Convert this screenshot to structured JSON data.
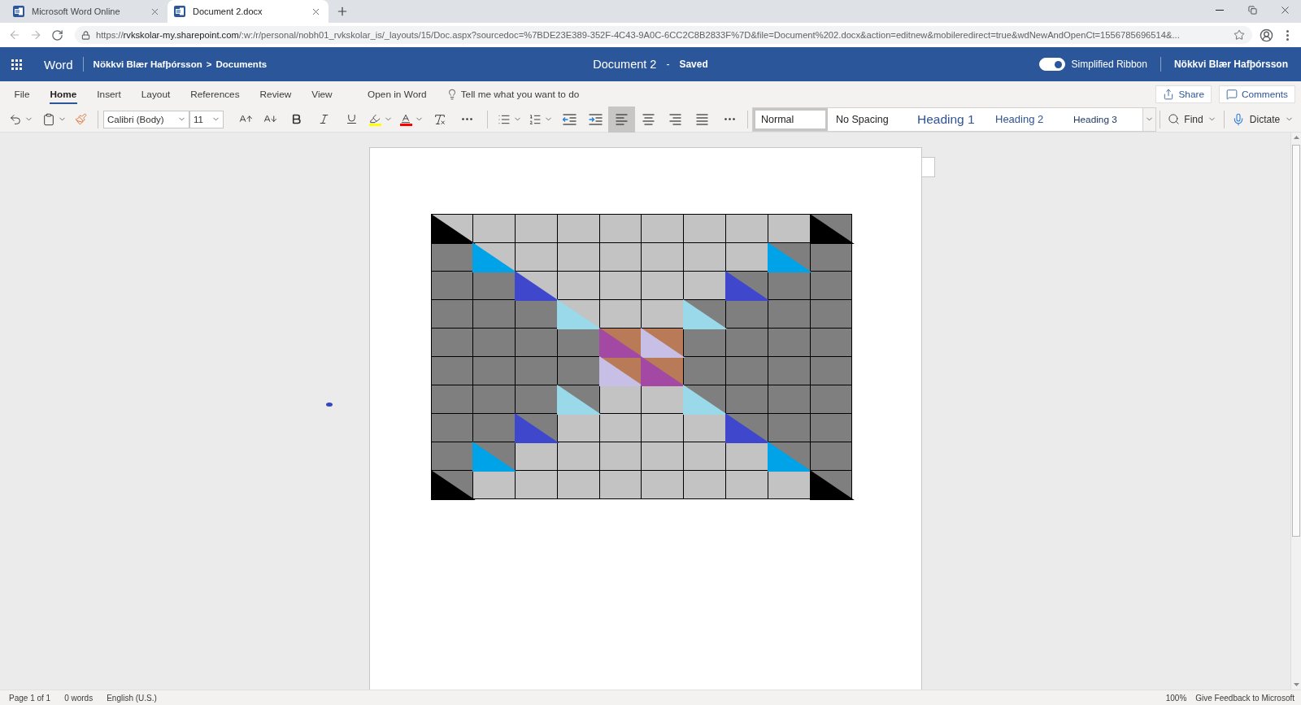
{
  "browser": {
    "tabs": [
      {
        "title": "Microsoft Word Online",
        "selected": false
      },
      {
        "title": "Document 2.docx",
        "selected": true
      }
    ],
    "address": {
      "scheme": "https://",
      "host": "rvkskolar-my.sharepoint.com",
      "rest": "/:w:/r/personal/nobh01_rvkskolar_is/_layouts/15/Doc.aspx?sourcedoc=%7BDE23E389-352F-4C43-9A0C-6CC2C8B2833F%7D&file=Document%202.docx&action=editnew&mobileredirect=true&wdNewAndOpenCt=1556785696514&..."
    }
  },
  "app_bar": {
    "app_name": "Word",
    "breadcrumb": {
      "owner": "Nökkvi Blær Hafþórsson",
      "separator": ">",
      "folder": "Documents"
    },
    "document_title": "Document 2",
    "title_separator": "-",
    "save_status": "Saved",
    "simplified_ribbon": {
      "label": "Simplified Ribbon",
      "on": true
    },
    "user_name": "Nökkvi Blær Hafþórsson"
  },
  "ribbon": {
    "tabs": [
      {
        "label": "File",
        "selected": false
      },
      {
        "label": "Home",
        "selected": true
      },
      {
        "label": "Insert",
        "selected": false
      },
      {
        "label": "Layout",
        "selected": false
      },
      {
        "label": "References",
        "selected": false
      },
      {
        "label": "Review",
        "selected": false
      },
      {
        "label": "View",
        "selected": false
      }
    ],
    "open_in_word": "Open in Word",
    "tell_me": "Tell me what you want to do",
    "share": "Share",
    "comments": "Comments"
  },
  "toolbar": {
    "font_name": "Calibri (Body)",
    "font_size": "11",
    "alignment": [
      {
        "selected": true
      },
      {
        "selected": false
      },
      {
        "selected": false
      },
      {
        "selected": false
      }
    ],
    "styles": [
      {
        "label": "Normal",
        "kind": "body",
        "selected": true
      },
      {
        "label": "No Spacing",
        "kind": "body",
        "selected": false
      },
      {
        "label": "Heading 1",
        "kind": "heading1",
        "selected": false
      },
      {
        "label": "Heading 2",
        "kind": "heading2",
        "selected": false
      },
      {
        "label": "Heading 3",
        "kind": "heading3",
        "selected": false
      }
    ],
    "find": "Find",
    "dictate": "Dictate"
  },
  "document": {
    "grid": {
      "rows": [
        {
          "cells": [
            {
              "kind": "split",
              "color": "#c3c3c3",
              "triangle": {
                "color": "#000000"
              }
            },
            {
              "kind": "plain",
              "color": "#c3c3c3"
            },
            {
              "kind": "plain",
              "color": "#c3c3c3"
            },
            {
              "kind": "plain",
              "color": "#c3c3c3"
            },
            {
              "kind": "plain",
              "color": "#c3c3c3"
            },
            {
              "kind": "plain",
              "color": "#c3c3c3"
            },
            {
              "kind": "plain",
              "color": "#c3c3c3"
            },
            {
              "kind": "plain",
              "color": "#c3c3c3"
            },
            {
              "kind": "plain",
              "color": "#c3c3c3"
            },
            {
              "kind": "split",
              "color": "#7f7f7f",
              "triangle": {
                "color": "#000000"
              }
            }
          ]
        },
        {
          "cells": [
            {
              "kind": "plain",
              "color": "#7f7f7f"
            },
            {
              "kind": "split",
              "color": "#c3c3c3",
              "triangle": {
                "color": "#00a2e8"
              }
            },
            {
              "kind": "plain",
              "color": "#c3c3c3"
            },
            {
              "kind": "plain",
              "color": "#c3c3c3"
            },
            {
              "kind": "plain",
              "color": "#c3c3c3"
            },
            {
              "kind": "plain",
              "color": "#c3c3c3"
            },
            {
              "kind": "plain",
              "color": "#c3c3c3"
            },
            {
              "kind": "plain",
              "color": "#c3c3c3"
            },
            {
              "kind": "split",
              "color": "#7f7f7f",
              "triangle": {
                "color": "#00a2e8"
              }
            },
            {
              "kind": "plain",
              "color": "#7f7f7f"
            }
          ]
        },
        {
          "cells": [
            {
              "kind": "plain",
              "color": "#7f7f7f"
            },
            {
              "kind": "plain",
              "color": "#7f7f7f"
            },
            {
              "kind": "split",
              "color": "#c3c3c3",
              "triangle": {
                "color": "#3f48cc"
              }
            },
            {
              "kind": "plain",
              "color": "#c3c3c3"
            },
            {
              "kind": "plain",
              "color": "#c3c3c3"
            },
            {
              "kind": "plain",
              "color": "#c3c3c3"
            },
            {
              "kind": "plain",
              "color": "#c3c3c3"
            },
            {
              "kind": "split",
              "color": "#7f7f7f",
              "triangle": {
                "color": "#3f48cc"
              }
            },
            {
              "kind": "plain",
              "color": "#7f7f7f"
            },
            {
              "kind": "plain",
              "color": "#7f7f7f"
            }
          ]
        },
        {
          "cells": [
            {
              "kind": "plain",
              "color": "#7f7f7f"
            },
            {
              "kind": "plain",
              "color": "#7f7f7f"
            },
            {
              "kind": "plain",
              "color": "#7f7f7f"
            },
            {
              "kind": "split",
              "color": "#c3c3c3",
              "triangle": {
                "color": "#99d9ea"
              }
            },
            {
              "kind": "plain",
              "color": "#c3c3c3"
            },
            {
              "kind": "plain",
              "color": "#c3c3c3"
            },
            {
              "kind": "split",
              "color": "#7f7f7f",
              "triangle": {
                "color": "#99d9ea"
              }
            },
            {
              "kind": "plain",
              "color": "#7f7f7f"
            },
            {
              "kind": "plain",
              "color": "#7f7f7f"
            },
            {
              "kind": "plain",
              "color": "#7f7f7f"
            }
          ]
        },
        {
          "cells": [
            {
              "kind": "plain",
              "color": "#7f7f7f"
            },
            {
              "kind": "plain",
              "color": "#7f7f7f"
            },
            {
              "kind": "plain",
              "color": "#7f7f7f"
            },
            {
              "kind": "plain",
              "color": "#7f7f7f"
            },
            {
              "kind": "split",
              "color": "#b97a57",
              "triangle": {
                "color": "#a349a4"
              }
            },
            {
              "kind": "split",
              "color": "#b97a57",
              "triangle": {
                "color": "#c8bfe7"
              }
            },
            {
              "kind": "plain",
              "color": "#7f7f7f"
            },
            {
              "kind": "plain",
              "color": "#7f7f7f"
            },
            {
              "kind": "plain",
              "color": "#7f7f7f"
            },
            {
              "kind": "plain",
              "color": "#7f7f7f"
            }
          ]
        },
        {
          "cells": [
            {
              "kind": "plain",
              "color": "#7f7f7f"
            },
            {
              "kind": "plain",
              "color": "#7f7f7f"
            },
            {
              "kind": "plain",
              "color": "#7f7f7f"
            },
            {
              "kind": "plain",
              "color": "#7f7f7f"
            },
            {
              "kind": "split",
              "color": "#b97a57",
              "triangle": {
                "color": "#c8bfe7"
              }
            },
            {
              "kind": "split",
              "color": "#b97a57",
              "triangle": {
                "color": "#a349a4"
              }
            },
            {
              "kind": "plain",
              "color": "#7f7f7f"
            },
            {
              "kind": "plain",
              "color": "#7f7f7f"
            },
            {
              "kind": "plain",
              "color": "#7f7f7f"
            },
            {
              "kind": "plain",
              "color": "#7f7f7f"
            }
          ]
        },
        {
          "cells": [
            {
              "kind": "plain",
              "color": "#7f7f7f"
            },
            {
              "kind": "plain",
              "color": "#7f7f7f"
            },
            {
              "kind": "plain",
              "color": "#7f7f7f"
            },
            {
              "kind": "split",
              "color": "#7f7f7f",
              "triangle": {
                "color": "#99d9ea"
              }
            },
            {
              "kind": "plain",
              "color": "#c3c3c3"
            },
            {
              "kind": "plain",
              "color": "#c3c3c3"
            },
            {
              "kind": "split",
              "color": "#7f7f7f",
              "triangle": {
                "color": "#99d9ea"
              }
            },
            {
              "kind": "plain",
              "color": "#7f7f7f"
            },
            {
              "kind": "plain",
              "color": "#7f7f7f"
            },
            {
              "kind": "plain",
              "color": "#7f7f7f"
            }
          ]
        },
        {
          "cells": [
            {
              "kind": "plain",
              "color": "#7f7f7f"
            },
            {
              "kind": "plain",
              "color": "#7f7f7f"
            },
            {
              "kind": "split",
              "color": "#7f7f7f",
              "triangle": {
                "color": "#3f48cc"
              }
            },
            {
              "kind": "plain",
              "color": "#c3c3c3"
            },
            {
              "kind": "plain",
              "color": "#c3c3c3"
            },
            {
              "kind": "plain",
              "color": "#c3c3c3"
            },
            {
              "kind": "plain",
              "color": "#c3c3c3"
            },
            {
              "kind": "split",
              "color": "#7f7f7f",
              "triangle": {
                "color": "#3f48cc"
              }
            },
            {
              "kind": "plain",
              "color": "#7f7f7f"
            },
            {
              "kind": "plain",
              "color": "#7f7f7f"
            }
          ]
        },
        {
          "cells": [
            {
              "kind": "plain",
              "color": "#7f7f7f"
            },
            {
              "kind": "split",
              "color": "#7f7f7f",
              "triangle": {
                "color": "#00a2e8"
              }
            },
            {
              "kind": "plain",
              "color": "#c3c3c3"
            },
            {
              "kind": "plain",
              "color": "#c3c3c3"
            },
            {
              "kind": "plain",
              "color": "#c3c3c3"
            },
            {
              "kind": "plain",
              "color": "#c3c3c3"
            },
            {
              "kind": "plain",
              "color": "#c3c3c3"
            },
            {
              "kind": "plain",
              "color": "#c3c3c3"
            },
            {
              "kind": "split",
              "color": "#7f7f7f",
              "triangle": {
                "color": "#00a2e8"
              }
            },
            {
              "kind": "plain",
              "color": "#7f7f7f"
            }
          ]
        },
        {
          "cells": [
            {
              "kind": "split",
              "color": "#7f7f7f",
              "triangle": {
                "color": "#000000"
              }
            },
            {
              "kind": "plain",
              "color": "#c3c3c3"
            },
            {
              "kind": "plain",
              "color": "#c3c3c3"
            },
            {
              "kind": "plain",
              "color": "#c3c3c3"
            },
            {
              "kind": "plain",
              "color": "#c3c3c3"
            },
            {
              "kind": "plain",
              "color": "#c3c3c3"
            },
            {
              "kind": "plain",
              "color": "#c3c3c3"
            },
            {
              "kind": "plain",
              "color": "#c3c3c3"
            },
            {
              "kind": "plain",
              "color": "#c3c3c3"
            },
            {
              "kind": "split",
              "color": "#7f7f7f",
              "triangle": {
                "color": "#000000"
              }
            }
          ]
        }
      ]
    }
  },
  "status_bar": {
    "page": "Page 1 of 1",
    "words": "0 words",
    "language": "English (U.S.)",
    "zoom": "100%",
    "feedback": "Give Feedback to Microsoft"
  }
}
